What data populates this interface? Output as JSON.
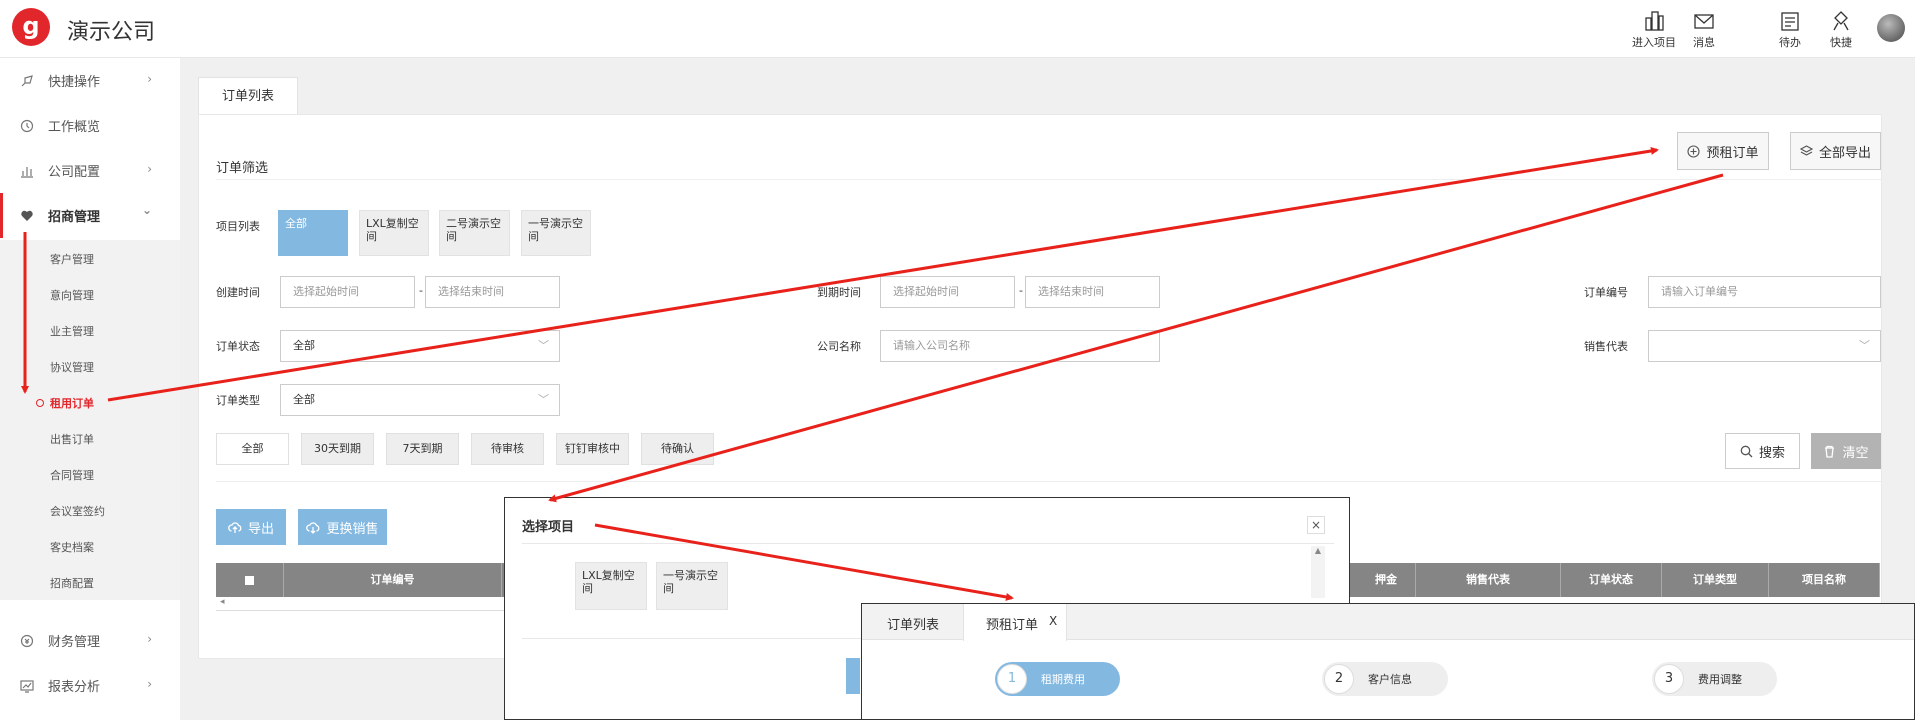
{
  "header": {
    "logo_letter": "g",
    "company": "演示公司",
    "icons": [
      {
        "label": "进入项目",
        "icon": "building-icon"
      },
      {
        "label": "消息",
        "icon": "mail-icon"
      },
      {
        "label": "待办",
        "icon": "clipboard-icon"
      },
      {
        "label": "快捷",
        "icon": "quick-icon"
      }
    ]
  },
  "sidebar": {
    "items": [
      {
        "label": "快捷操作",
        "icon": "rocket-icon",
        "chevron": "›"
      },
      {
        "label": "工作概览",
        "icon": "clock-icon",
        "chevron": ""
      },
      {
        "label": "公司配置",
        "icon": "chart-icon",
        "chevron": "›"
      },
      {
        "label": "招商管理",
        "icon": "heart-icon",
        "chevron": "⌄"
      },
      {
        "label": "财务管理",
        "icon": "money-icon",
        "chevron": "›"
      },
      {
        "label": "报表分析",
        "icon": "report-icon",
        "chevron": "›"
      }
    ],
    "sub_items": [
      "客户管理",
      "意向管理",
      "业主管理",
      "协议管理",
      "租用订单",
      "出售订单",
      "合同管理",
      "会议室签约",
      "客史档案",
      "招商配置"
    ]
  },
  "main": {
    "tab": "订单列表",
    "filter_title": "订单筛选",
    "pre_rent_button": "预租订单",
    "export_all_button": "全部导出",
    "project_label": "项目列表",
    "project_chips": [
      "全部",
      "LXL复制空间",
      "二号演示空间",
      "一号演示空间"
    ],
    "create_time_label": "创建时间",
    "start_placeholder": "选择起始时间",
    "end_placeholder": "选择结束时间",
    "dash": "-",
    "expire_time_label": "到期时间",
    "order_no_label": "订单编号",
    "order_no_placeholder": "请输入订单编号",
    "order_status_label": "订单状态",
    "order_status_value": "全部",
    "company_label": "公司名称",
    "company_placeholder": "请输入公司名称",
    "sales_label": "销售代表",
    "order_type_label": "订单类型",
    "order_type_value": "全部",
    "quick_filters": [
      "全部",
      "30天到期",
      "7天到期",
      "待审核",
      "钉钉审核中",
      "待确认"
    ],
    "search_button": "搜索",
    "clear_button": "清空",
    "export_button": "导出",
    "change_sales_button": "更换销售",
    "table_headers": [
      "订单编号",
      "押金",
      "销售代表",
      "订单状态",
      "订单类型",
      "项目名称"
    ]
  },
  "dialog_select": {
    "title": "选择项目",
    "close": "×",
    "chips": [
      "LXL复制空间",
      "一号演示空间"
    ]
  },
  "dialog_order": {
    "tabs": [
      "订单列表",
      "预租订单"
    ],
    "tab_close": "X",
    "steps": [
      {
        "num": "1",
        "label": "租期费用"
      },
      {
        "num": "2",
        "label": "客户信息"
      },
      {
        "num": "3",
        "label": "费用调整"
      }
    ]
  },
  "colors": {
    "brand": "#e2272c",
    "accent": "#83b8e1",
    "annotation": "#e8221b"
  }
}
